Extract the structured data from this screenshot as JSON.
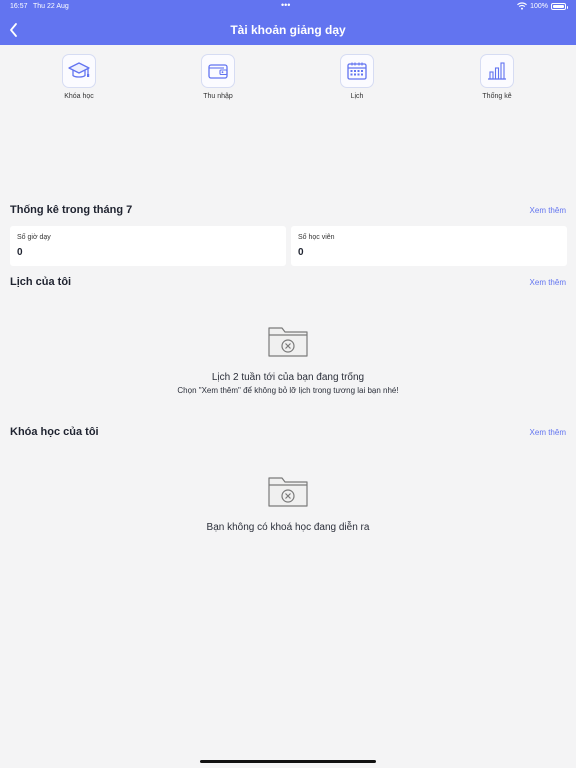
{
  "status_bar": {
    "time": "16:57",
    "date": "Thu 22 Aug",
    "dots": "•••",
    "battery": "100%"
  },
  "header": {
    "title": "Tài khoản giảng dạy"
  },
  "menu": [
    {
      "label": "Khóa học",
      "icon": "graduation-cap-icon"
    },
    {
      "label": "Thu nhập",
      "icon": "wallet-icon"
    },
    {
      "label": "Lịch",
      "icon": "calendar-icon"
    },
    {
      "label": "Thống kê",
      "icon": "bar-chart-icon"
    }
  ],
  "stats": {
    "title": "Thống kê trong tháng 7",
    "see_more": "Xem thêm",
    "cards": [
      {
        "label": "Số giờ dạy",
        "value": "0"
      },
      {
        "label": "Số học viên",
        "value": "0"
      }
    ]
  },
  "schedule": {
    "title": "Lịch của tôi",
    "see_more": "Xem thêm",
    "empty_title": "Lịch 2 tuần tới của bạn đang trống",
    "empty_sub": "Chọn \"Xem thêm\" để không bỏ lỡ lịch trong tương lai bạn nhé!"
  },
  "courses": {
    "title": "Khóa học của tôi",
    "see_more": "Xem thêm",
    "empty_title": "Bạn không có khoá học đang diễn ra"
  },
  "colors": {
    "accent": "#6274f0",
    "background": "#f4f4f5"
  }
}
